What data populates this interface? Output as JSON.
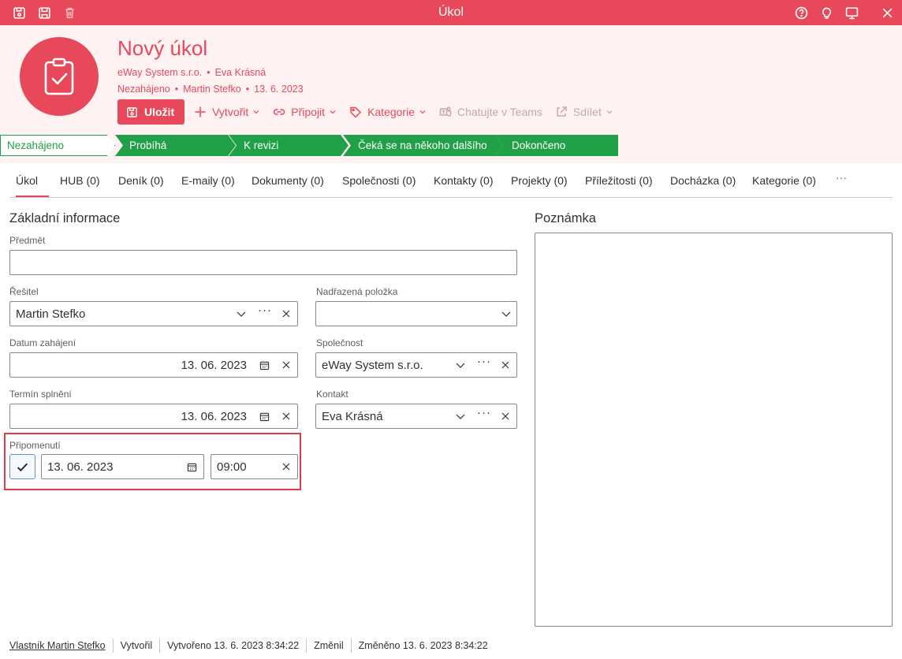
{
  "window": {
    "title": "Úkol"
  },
  "record": {
    "title": "Nový úkol",
    "company": "eWay System s.r.o.",
    "contact": "Eva Krásná",
    "status": "Nezahájeno",
    "owner": "Martin Stefko",
    "date": "13. 6. 2023"
  },
  "toolbar": {
    "save": "Uložit",
    "create": "Vytvořit",
    "attach": "Připojit",
    "category": "Kategorie",
    "teams": "Chatujte v Teams",
    "share": "Sdílet"
  },
  "stages": [
    "Nezahájeno",
    "Probíhá",
    "K revizi",
    "Čeká se na někoho dalšího",
    "Dokončeno"
  ],
  "tabs": [
    "Úkol",
    "HUB (0)",
    "Deník (0)",
    "E-maily (0)",
    "Dokumenty (0)",
    "Společnosti (0)",
    "Kontakty (0)",
    "Projekty (0)",
    "Příležitosti (0)",
    "Docházka (0)",
    "Kategorie (0)",
    "···"
  ],
  "form": {
    "section_basic": "Základní informace",
    "section_note": "Poznámka",
    "subject_label": "Předmět",
    "subject_value": "",
    "solver_label": "Řešitel",
    "solver_value": "Martin Stefko",
    "parent_label": "Nadřazená položka",
    "parent_value": "",
    "start_label": "Datum zahájení",
    "start_value": "13. 06. 2023",
    "company_label": "Společnost",
    "company_value": "eWay System s.r.o.",
    "due_label": "Termín splnění",
    "due_value": "13. 06. 2023",
    "contact_label": "Kontakt",
    "contact_value": "Eva Krásná",
    "reminder_label": "Připomenutí",
    "reminder_date": "13. 06. 2023",
    "reminder_time": "09:00",
    "reminder_checked": true
  },
  "footer": {
    "owner": "Vlastník Martin Stefko",
    "created_by": "Vytvořil",
    "created": "Vytvořeno 13. 6. 2023 8:34:22",
    "changed_by": "Změnil",
    "changed": "Změněno 13. 6. 2023 8:34:22"
  },
  "colors": {
    "brand": "#e8495a",
    "header_bg": "#fff2f3",
    "stage_green": "#21a147",
    "highlight": "#e03a47"
  },
  "icons": {
    "titlebar_left": [
      "save-icon",
      "save-as-icon",
      "trash-icon"
    ],
    "titlebar_right": [
      "help-icon",
      "lightbulb-icon",
      "monitor-icon",
      "close-icon"
    ],
    "avatar": "clipboard-check-icon"
  }
}
